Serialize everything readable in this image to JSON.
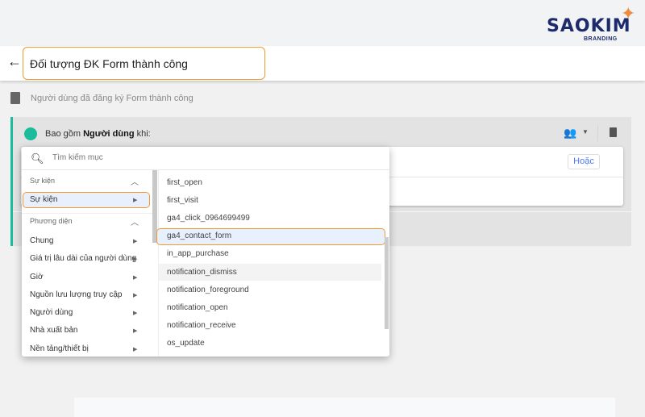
{
  "brand": {
    "logo_text": "SAOKIM",
    "logo_sub": "BRANDING",
    "accent": "#f39a2d",
    "teal": "#1bbc9b"
  },
  "header": {
    "title_value": "Đối tượng ĐK Form thành công"
  },
  "description": "Người dùng đã đăng ký Form thành công",
  "condition": {
    "prefix": "Bao gồm",
    "subject": "Người dùng",
    "suffix": "khi:",
    "or_button": "Hoặc"
  },
  "menu": {
    "search_placeholder": "Tìm kiếm mục",
    "events_header": "Sự kiện",
    "events_item": "Sự kiện",
    "dimensions_header": "Phương diện",
    "dimensions": [
      "Chung",
      "Giá trị lâu dài của người dùng",
      "Giờ",
      "Nguồn lưu lượng truy cập",
      "Người dùng",
      "Nhà xuất bản",
      "Nền tảng/thiết bị"
    ],
    "events": [
      "first_open",
      "first_visit",
      "ga4_click_0964699499",
      "ga4_contact_form",
      "in_app_purchase",
      "notification_dismiss",
      "notification_foreground",
      "notification_open",
      "notification_receive",
      "os_update"
    ],
    "selected_event": "ga4_contact_form",
    "hovered_event": "notification_dismiss"
  }
}
